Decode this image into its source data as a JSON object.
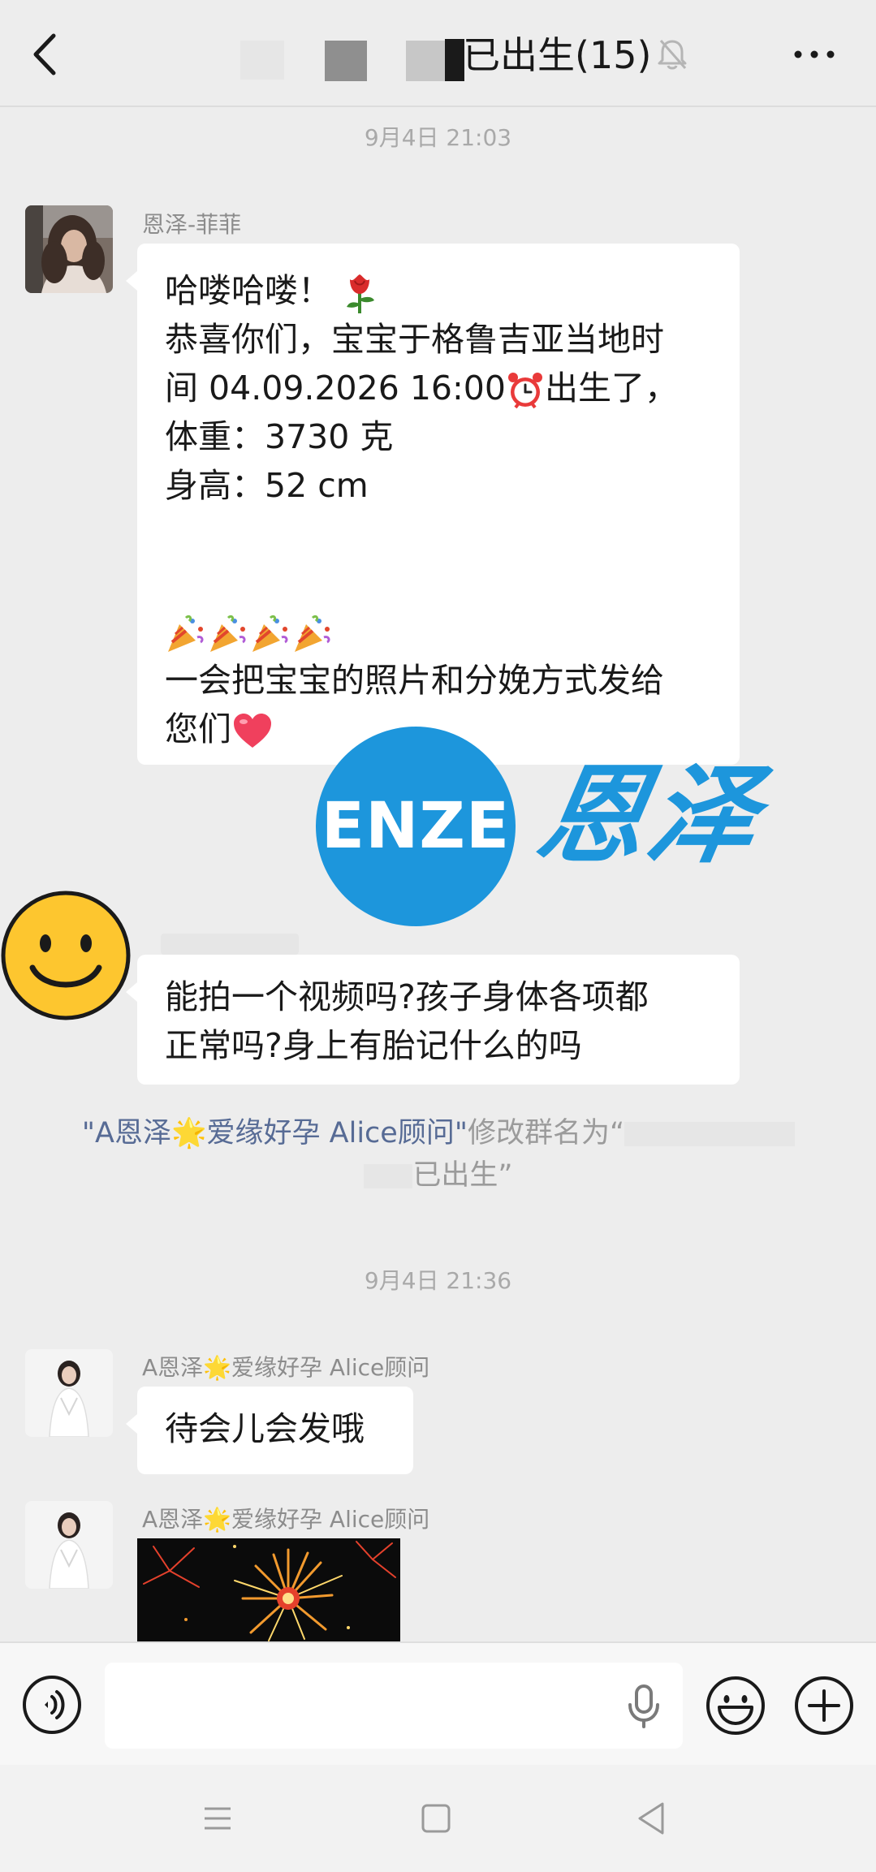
{
  "header": {
    "title": "已出生(15)",
    "back_icon": "chevron-left-icon",
    "mute_icon": "bell-muted-icon",
    "more_icon": "more-dots-icon"
  },
  "timestamps": [
    "9月4日 21:03",
    "9月4日 21:36"
  ],
  "messages": [
    {
      "sender": "恩泽-菲菲",
      "lines": [
        "哈喽哈喽！ 🌹",
        "恭喜你们，宝宝于格鲁吉亚当地时",
        "间 04.09.2026 16:00⏰出生了，",
        "体重：3730 克",
        "身高：52 cm",
        "",
        "",
        "🎉🎉🎉🎉",
        "一会把宝宝的照片和分娩方式发给",
        "您们❤️"
      ]
    },
    {
      "sender": "",
      "lines": [
        "能拍一个视频吗?孩子身体各项都",
        "正常吗?身上有胎记什么的吗"
      ]
    },
    {
      "sender": "A恩泽🌟爱缘好孕 Alice顾问",
      "lines": [
        "待会儿会发哦"
      ]
    },
    {
      "sender": "A恩泽🌟爱缘好孕 Alice顾问",
      "lines": []
    }
  ],
  "system_notice": {
    "actor": "\"A恩泽🌟爱缘好孕 Alice顾问\"",
    "text": "修改群名为“",
    "text_end": "已出生”"
  },
  "watermark": {
    "latin": "ENZE",
    "chinese": "恩泽",
    "color": "#1d96dc"
  },
  "input_bar": {
    "placeholder": "",
    "voice_icon": "voice-icon",
    "mic_icon": "microphone-icon",
    "emoji_icon": "emoji-icon",
    "plus_icon": "plus-icon"
  },
  "colors": {
    "background": "#ededed",
    "bubble": "#ffffff",
    "link": "#576b95",
    "muted_text": "#a9a9a9"
  }
}
